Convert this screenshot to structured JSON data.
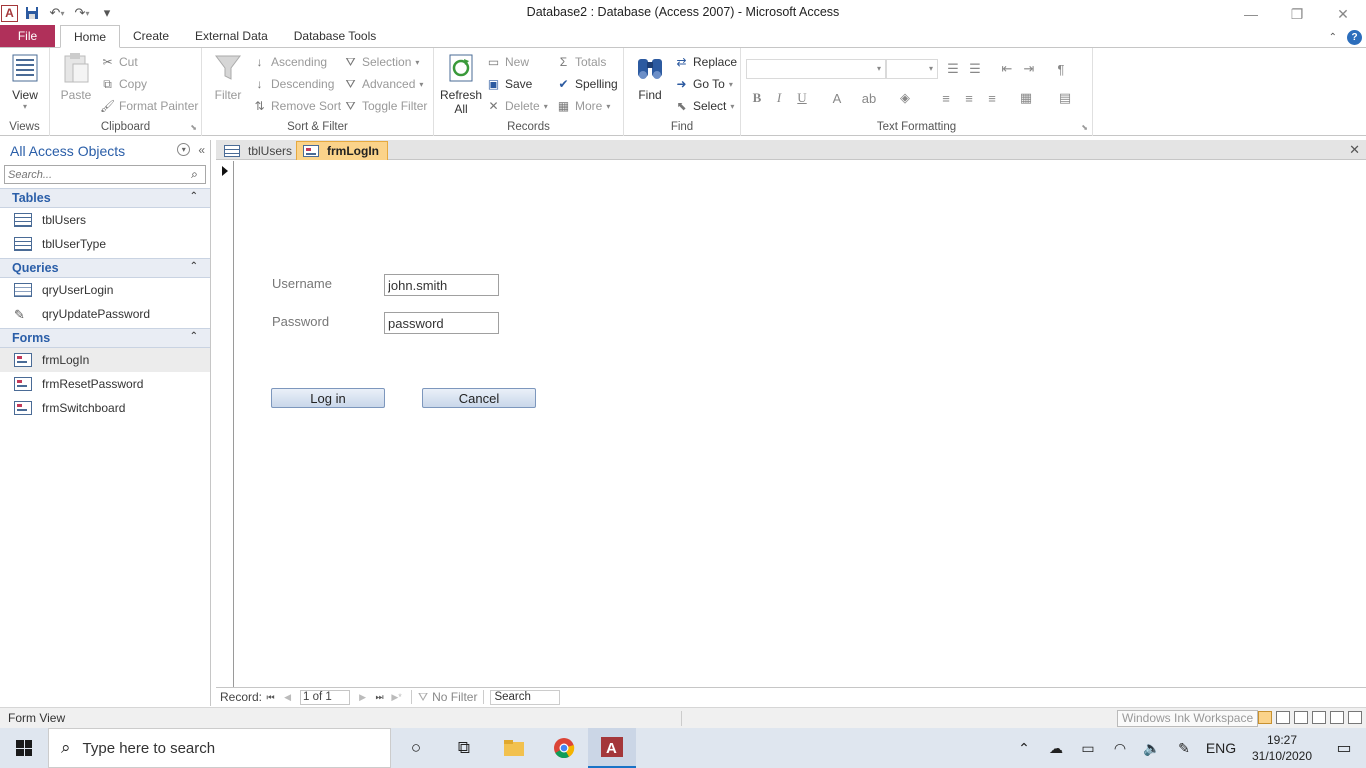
{
  "window": {
    "title": "Database2 : Database (Access 2007)  -  Microsoft Access",
    "app_letter": "A"
  },
  "ribbon_tabs": [
    "File",
    "Home",
    "Create",
    "External Data",
    "Database Tools"
  ],
  "ribbon": {
    "views": {
      "view_label": "View",
      "group": "Views"
    },
    "clipboard": {
      "paste": "Paste",
      "cut": "Cut",
      "copy": "Copy",
      "format_painter": "Format Painter",
      "group": "Clipboard"
    },
    "sort_filter": {
      "filter": "Filter",
      "ascending": "Ascending",
      "descending": "Descending",
      "remove_sort": "Remove Sort",
      "selection": "Selection",
      "advanced": "Advanced",
      "toggle_filter": "Toggle Filter",
      "group": "Sort & Filter"
    },
    "records": {
      "refresh": "Refresh",
      "refresh_sub": "All",
      "new": "New",
      "save": "Save",
      "delete": "Delete",
      "totals": "Totals",
      "spelling": "Spelling",
      "more": "More",
      "group": "Records"
    },
    "find": {
      "find": "Find",
      "replace": "Replace",
      "goto": "Go To",
      "select": "Select",
      "group": "Find"
    },
    "text_formatting": {
      "bold": "B",
      "italic": "I",
      "underline": "U",
      "group": "Text Formatting"
    }
  },
  "nav_pane": {
    "title": "All Access Objects",
    "search_placeholder": "Search...",
    "categories": [
      {
        "name": "Tables",
        "items": [
          "tblUsers",
          "tblUserType"
        ]
      },
      {
        "name": "Queries",
        "items": [
          "qryUserLogin",
          "qryUpdatePassword"
        ]
      },
      {
        "name": "Forms",
        "items": [
          "frmLogIn",
          "frmResetPassword",
          "frmSwitchboard"
        ]
      }
    ],
    "selected_item": "frmLogIn"
  },
  "doc_tabs": [
    {
      "label": "tblUsers",
      "active": false
    },
    {
      "label": "frmLogIn",
      "active": true
    }
  ],
  "form": {
    "username_label": "Username",
    "username_value": "john.smith",
    "password_label": "Password",
    "password_value": "password",
    "login_button": "Log in",
    "cancel_button": "Cancel"
  },
  "record_nav": {
    "label": "Record:",
    "current": "1 of 1",
    "filter_status": "No Filter",
    "search": "Search"
  },
  "status": {
    "view": "Form View",
    "ink_tooltip": "Windows Ink Workspace"
  },
  "taskbar": {
    "search_placeholder": "Type here to search",
    "language": "ENG",
    "time": "19:27",
    "date": "31/10/2020"
  },
  "colors": {
    "file_tab": "#b0305a",
    "nav_accent": "#2a5ea8",
    "active_doc_tab": "#fbd38a"
  }
}
